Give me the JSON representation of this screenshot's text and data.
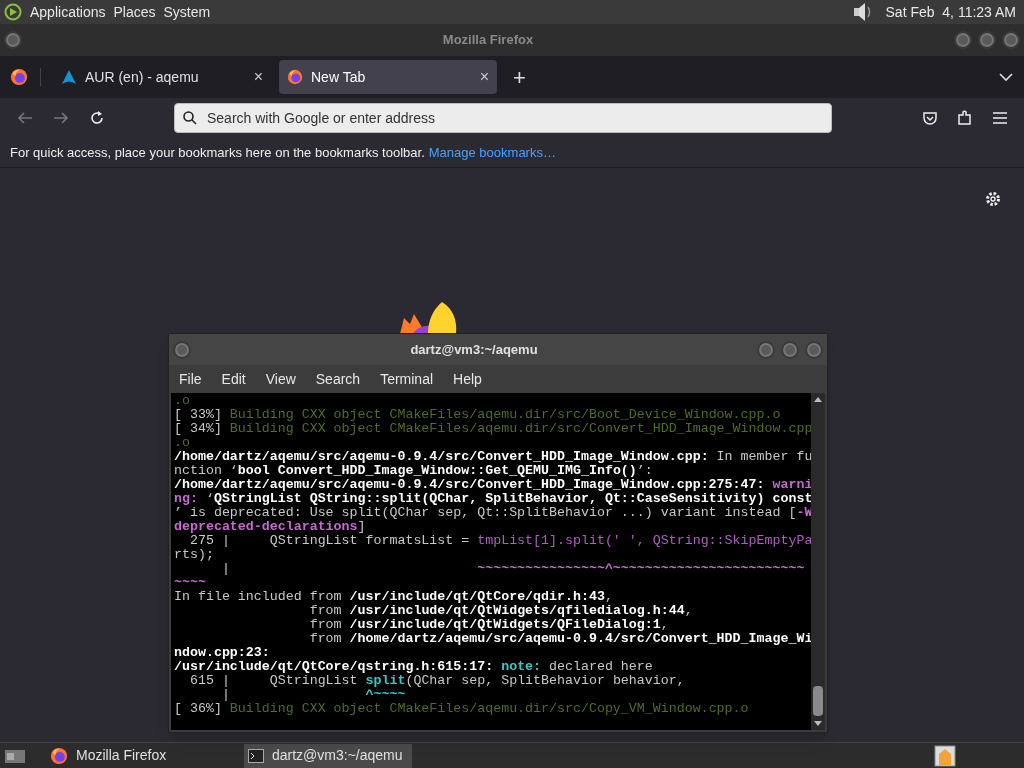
{
  "top_panel": {
    "menus": [
      "Applications",
      "Places",
      "System"
    ],
    "clock": "Sat Feb  4, 11:23 AM"
  },
  "browser": {
    "title": "Mozilla Firefox",
    "tabs": [
      {
        "label": "AUR (en) - aqemu",
        "close": "×",
        "kind": "arch",
        "selected": false
      },
      {
        "label": "New Tab",
        "close": "×",
        "kind": "firefox",
        "selected": true
      }
    ],
    "new_tab": "+",
    "address": {
      "placeholder": "Search with Google or enter address"
    },
    "bookmarks_bar": {
      "text": "For quick access, place your bookmarks here on the bookmarks toolbar.",
      "link": "Manage bookmarks…"
    }
  },
  "terminal": {
    "title": "dartz@vm3:~/aqemu",
    "menu": [
      "File",
      "Edit",
      "View",
      "Search",
      "Terminal",
      "Help"
    ],
    "lines": [
      {
        "segments": [
          {
            "kind": "dim",
            "text": ".o"
          }
        ]
      },
      {
        "segments": [
          {
            "kind": "plain",
            "text": "[ 33%] "
          },
          {
            "kind": "dim",
            "text": "Building CXX object CMakeFiles/aqemu.dir/src/Boot_Device_Window.cpp.o"
          }
        ]
      },
      {
        "segments": [
          {
            "kind": "plain",
            "text": "[ 34%] "
          },
          {
            "kind": "dim",
            "text": "Building CXX object CMakeFiles/aqemu.dir/src/Convert_HDD_Image_Window.cpp"
          }
        ]
      },
      {
        "segments": [
          {
            "kind": "dim",
            "text": ".o"
          }
        ]
      },
      {
        "segments": [
          {
            "kind": "bold",
            "text": "/home/dartz/aqemu/src/aqemu-0.9.4/src/Convert_HDD_Image_Window.cpp:"
          },
          {
            "kind": "plain",
            "text": " In member fu"
          }
        ]
      },
      {
        "segments": [
          {
            "kind": "plain",
            "text": "nction ‘"
          },
          {
            "kind": "bold",
            "text": "bool Convert_HDD_Image_Window::Get_QEMU_IMG_Info()"
          },
          {
            "kind": "plain",
            "text": "’:"
          }
        ]
      },
      {
        "segments": [
          {
            "kind": "bold",
            "text": "/home/dartz/aqemu/src/aqemu-0.9.4/src/Convert_HDD_Image_Window.cpp:275:47: "
          },
          {
            "kind": "warn",
            "text": "warni"
          }
        ]
      },
      {
        "segments": [
          {
            "kind": "warn",
            "text": "ng:"
          },
          {
            "kind": "plain",
            "text": " ‘"
          },
          {
            "kind": "bold",
            "text": "QStringList QString::split(QChar, SplitBehavior, Qt::CaseSensitivity) const"
          }
        ]
      },
      {
        "segments": [
          {
            "kind": "plain",
            "text": "’ is deprecated: Use split(QChar sep, Qt::SplitBehavior ...) variant instead ["
          },
          {
            "kind": "warn",
            "text": "-W"
          }
        ]
      },
      {
        "segments": [
          {
            "kind": "warn",
            "text": "deprecated-declarations"
          },
          {
            "kind": "plain",
            "text": "]"
          }
        ]
      },
      {
        "segments": [
          {
            "kind": "plain",
            "text": "  275 |     QStringList formatsList = "
          },
          {
            "kind": "hl",
            "text": "tmpList[1].split(' ', QString::SkipEmptyPa"
          }
        ]
      },
      {
        "segments": [
          {
            "kind": "plain",
            "text": "rts);"
          }
        ]
      },
      {
        "segments": [
          {
            "kind": "plain",
            "text": "      |                               "
          },
          {
            "kind": "warn",
            "text": "~~~~~~~~~~~~~~~~^~~~~~~~~~~~~~~~~~~~~~~~~"
          }
        ]
      },
      {
        "segments": [
          {
            "kind": "warn",
            "text": "~~~~"
          }
        ]
      },
      {
        "segments": [
          {
            "kind": "plain",
            "text": "In file included from "
          },
          {
            "kind": "bold",
            "text": "/usr/include/qt/QtCore/qdir.h:43"
          },
          {
            "kind": "plain",
            "text": ","
          }
        ]
      },
      {
        "segments": [
          {
            "kind": "plain",
            "text": "                 from "
          },
          {
            "kind": "bold",
            "text": "/usr/include/qt/QtWidgets/qfiledialog.h:44"
          },
          {
            "kind": "plain",
            "text": ","
          }
        ]
      },
      {
        "segments": [
          {
            "kind": "plain",
            "text": "                 from "
          },
          {
            "kind": "bold",
            "text": "/usr/include/qt/QtWidgets/QFileDialog:1"
          },
          {
            "kind": "plain",
            "text": ","
          }
        ]
      },
      {
        "segments": [
          {
            "kind": "plain",
            "text": "                 from "
          },
          {
            "kind": "bold",
            "text": "/home/dartz/aqemu/src/aqemu-0.9.4/src/Convert_HDD_Image_Wi"
          }
        ]
      },
      {
        "segments": [
          {
            "kind": "bold",
            "text": "ndow.cpp:23:"
          }
        ]
      },
      {
        "segments": [
          {
            "kind": "bold",
            "text": "/usr/include/qt/QtCore/qstring.h:615:17: "
          },
          {
            "kind": "note",
            "text": "note:"
          },
          {
            "kind": "plain",
            "text": " declared here"
          }
        ]
      },
      {
        "segments": [
          {
            "kind": "plain",
            "text": "  615 |     QStringList "
          },
          {
            "kind": "note",
            "text": "split"
          },
          {
            "kind": "plain",
            "text": "(QChar sep, SplitBehavior behavior,"
          }
        ]
      },
      {
        "segments": [
          {
            "kind": "plain",
            "text": "      |                 "
          },
          {
            "kind": "note",
            "text": "^~~~~"
          }
        ]
      },
      {
        "segments": [
          {
            "kind": "plain",
            "text": "[ 36%] "
          },
          {
            "kind": "dim",
            "text": "Building CXX object CMakeFiles/aqemu.dir/src/Copy_VM_Window.cpp.o"
          }
        ]
      }
    ]
  },
  "taskbar": {
    "items": [
      {
        "label": "Mozilla Firefox",
        "kind": "firefox",
        "selected": false
      },
      {
        "label": "dartz@vm3:~/aqemu",
        "kind": "terminal",
        "selected": true
      }
    ]
  }
}
